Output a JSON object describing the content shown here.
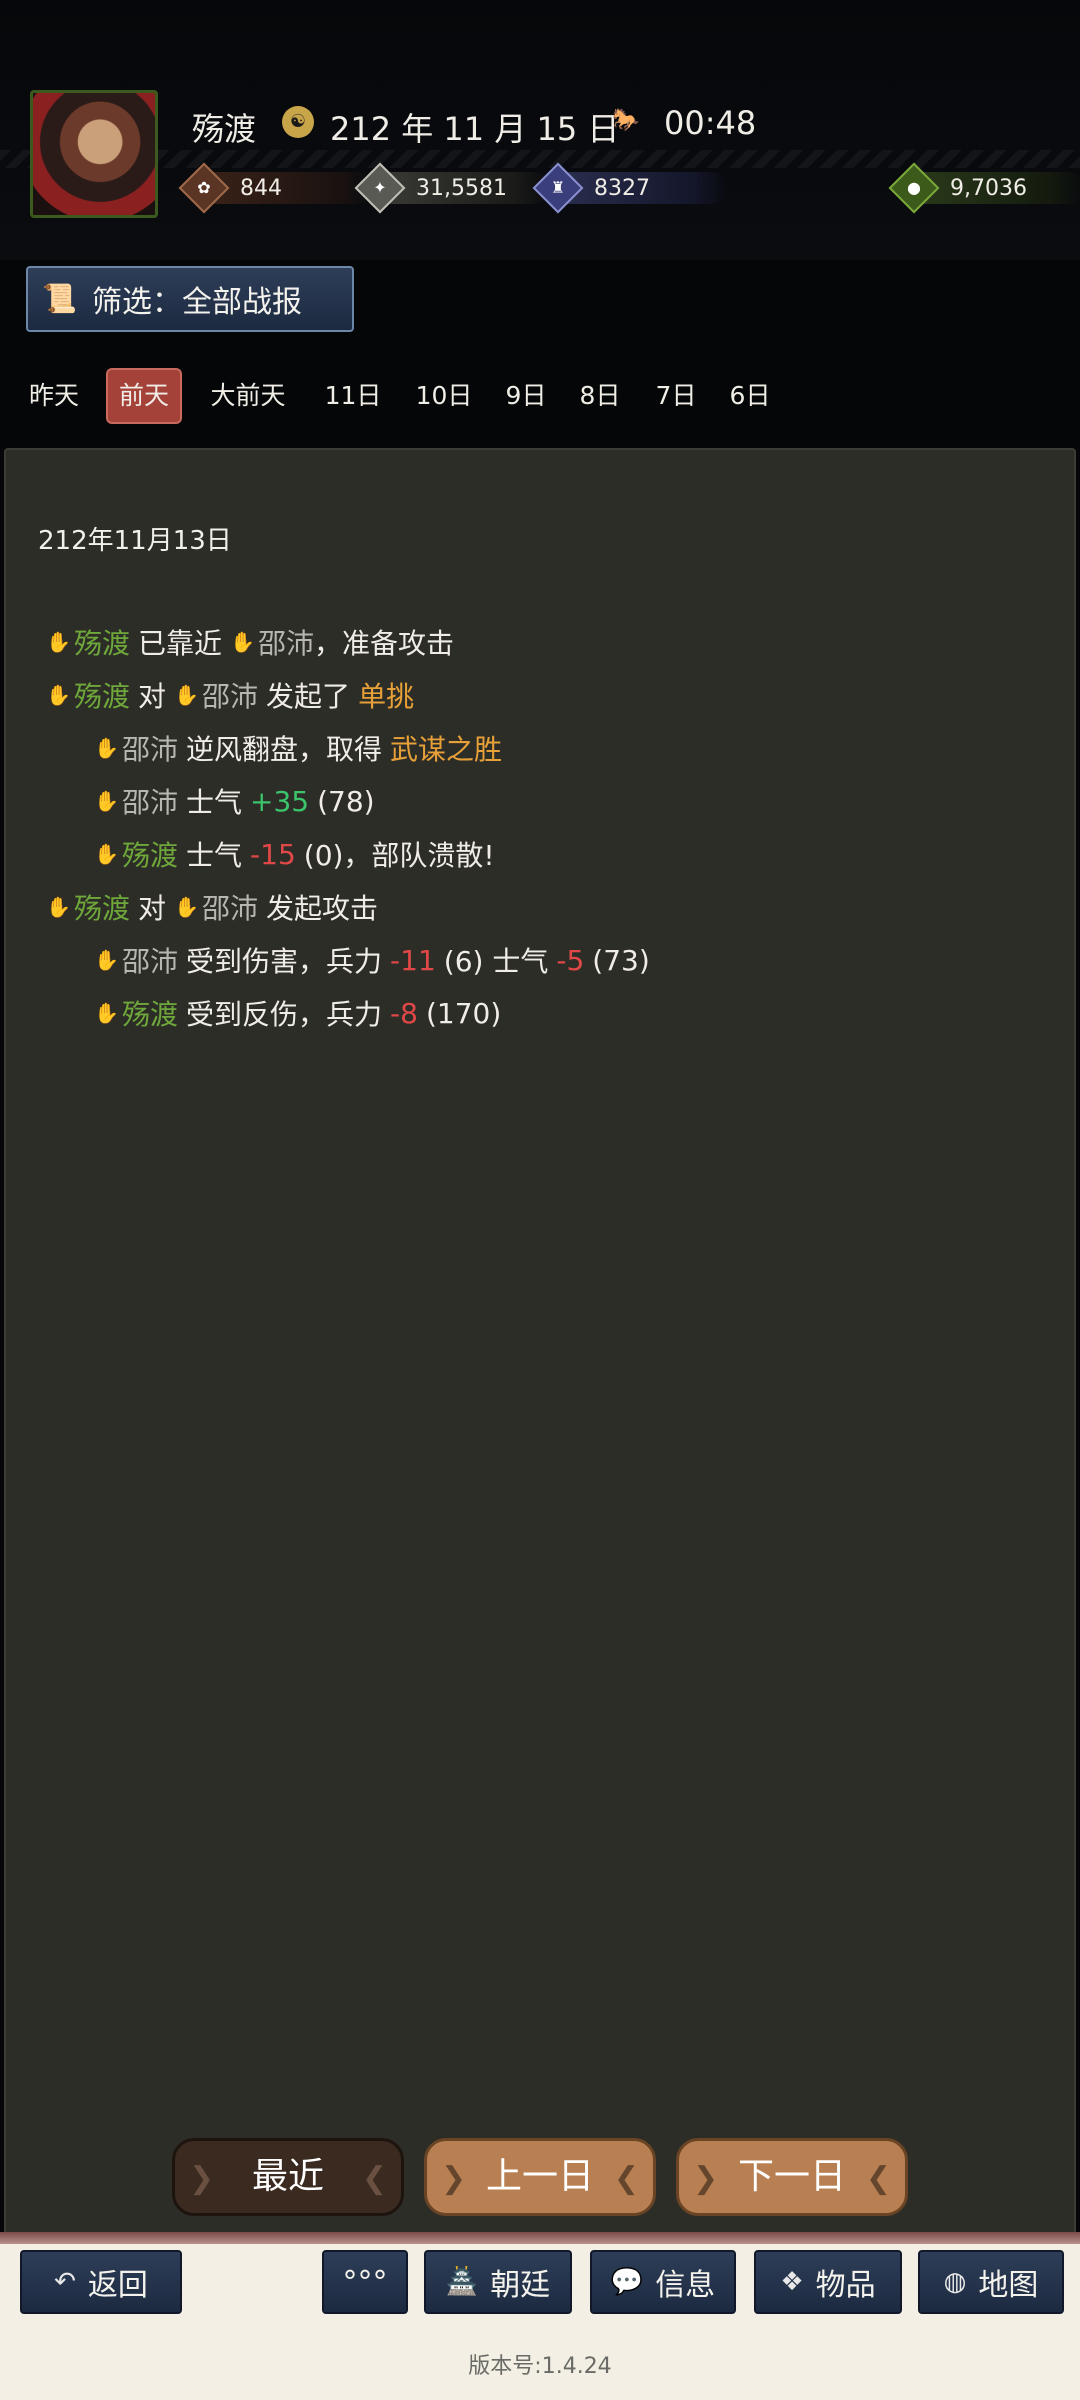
{
  "header": {
    "player_name": "殇渡",
    "date_icon": "calendar-emblem-icon",
    "game_date": "212 年 11 月 15 日",
    "time_icon": "horse-icon",
    "game_time": "00:48",
    "resources": {
      "food": "844",
      "iron": "31,5581",
      "troops": "8327",
      "coin": "9,7036"
    }
  },
  "filter": {
    "label": "筛选：全部战报",
    "icon": "scroll-icon"
  },
  "tabs": [
    "昨天",
    "前天",
    "大前天",
    "11日",
    "10日",
    "9日",
    "8日",
    "7日",
    "6日"
  ],
  "active_tab": "前天",
  "report": {
    "date": "212年11月13日",
    "lines": [
      {
        "a": "殇渡",
        "t1": "已靠近",
        "b": "邵沛",
        "t2": "，准备攻击"
      },
      {
        "a": "殇渡",
        "t1": "对",
        "b": "邵沛",
        "t2": "发起了",
        "hl": "单挑"
      },
      {
        "b": "邵沛",
        "t1": "逆风翻盘，取得",
        "hl": "武谋之胜"
      },
      {
        "b": "邵沛",
        "t1": "士气",
        "v": "+35",
        "t2": "(78)"
      },
      {
        "a": "殇渡",
        "t1": "士气",
        "v": "-15",
        "t2": "(0)，部队溃散!"
      },
      {
        "a": "殇渡",
        "t1": "对",
        "b": "邵沛",
        "t2": "发起攻击"
      },
      {
        "b": "邵沛",
        "t1": "受到伤害，兵力",
        "v": "-11",
        "t2": "(6) 士气",
        "v2": "-5",
        "t3": "(73)"
      },
      {
        "a": "殇渡",
        "t1": "受到反伤，兵力",
        "v": "-8",
        "t2": "(170)"
      }
    ]
  },
  "nav": {
    "recent": "最近",
    "prev": "上一日",
    "next": "下一日"
  },
  "bottom": {
    "back": "返回",
    "more": "°°°",
    "court": "朝廷",
    "messages": "信息",
    "items": "物品",
    "map": "地图",
    "version": "版本号:1.4.24"
  },
  "colors": {
    "self_green": "#6fa83a",
    "enemy_gray": "#b8b6b0",
    "highlight_orange": "#e8a038",
    "negative_red": "#e04848",
    "positive_green": "#3cc46a",
    "active_tab": "#a4423a",
    "button_blue": "#2e3e58",
    "button_brown": "#b88052"
  }
}
